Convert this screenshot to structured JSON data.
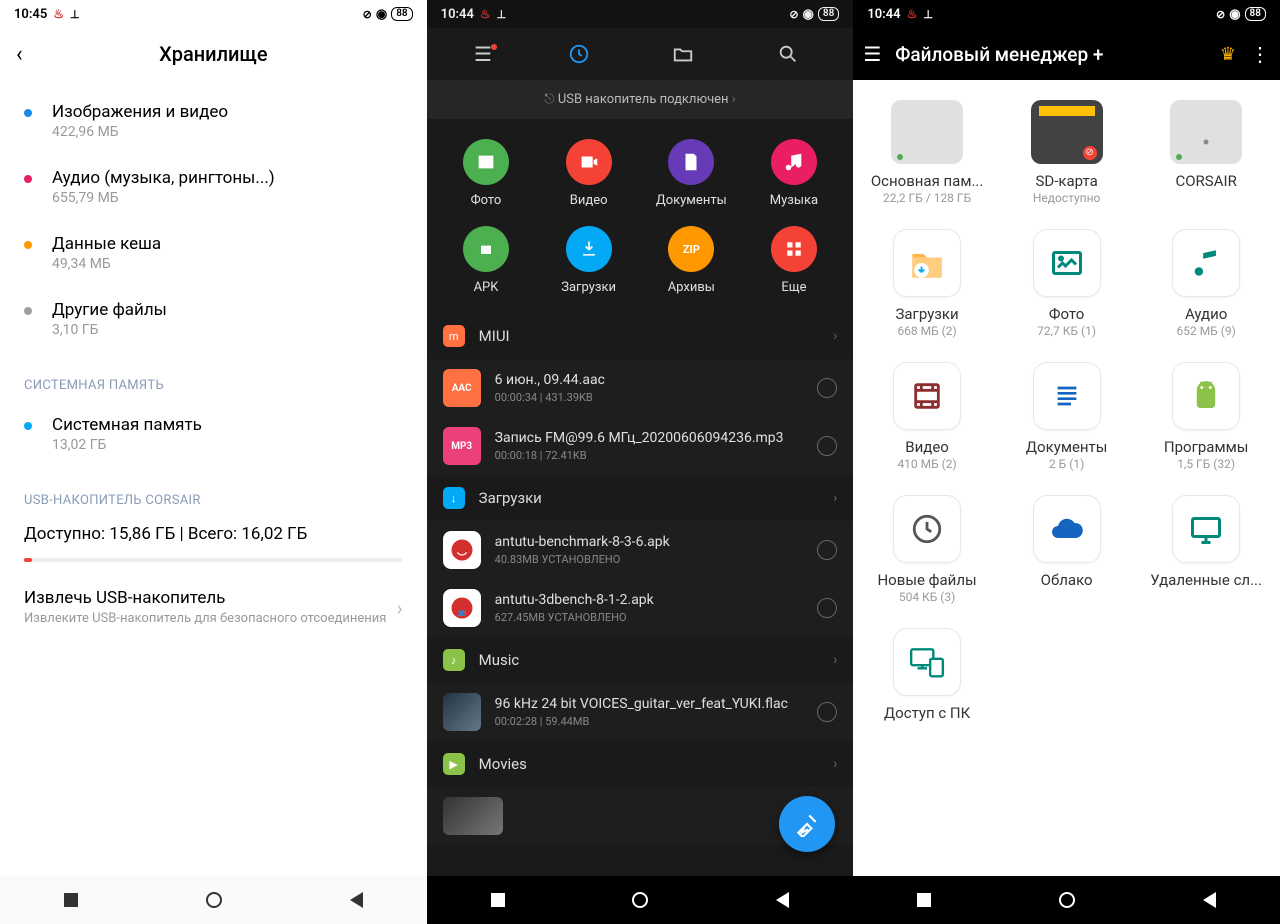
{
  "status": {
    "time1": "10:45",
    "time2": "10:44",
    "time3": "10:44",
    "battery": "88"
  },
  "s1": {
    "title": "Хранилище",
    "items": [
      {
        "label": "Изображения и видео",
        "size": "422,96 МБ",
        "color": "#1e88e5"
      },
      {
        "label": "Аудио (музыка, рингтоны...)",
        "size": "655,79 МБ",
        "color": "#e91e63"
      },
      {
        "label": "Данные кеша",
        "size": "49,34 МБ",
        "color": "#ff9800"
      },
      {
        "label": "Другие файлы",
        "size": "3,10 ГБ",
        "color": "#9e9e9e"
      }
    ],
    "sect_sys": "СИСТЕМНАЯ ПАМЯТЬ",
    "sys_label": "Системная память",
    "sys_size": "13,02 ГБ",
    "sect_usb": "USB-НАКОПИТЕЛЬ CORSAIR",
    "usb_status": "Доступно: 15,86 ГБ | Всего: 16,02 ГБ",
    "eject": "Извлечь USB-накопитель",
    "eject_sub": "Извлеките USB-накопитель для безопасного отсоединения"
  },
  "s2": {
    "banner": "USB накопитель подключен",
    "cats": [
      {
        "label": "Фото",
        "color": "#4caf50"
      },
      {
        "label": "Видео",
        "color": "#f44336"
      },
      {
        "label": "Документы",
        "color": "#673ab7"
      },
      {
        "label": "Музыка",
        "color": "#e91e63"
      },
      {
        "label": "APK",
        "color": "#4caf50"
      },
      {
        "label": "Загрузки",
        "color": "#03a9f4"
      },
      {
        "label": "Архивы",
        "color": "#ff9800"
      },
      {
        "label": "Еще",
        "color": "#f44336"
      }
    ],
    "grp_miui": "MIUI",
    "f1": {
      "name": "6 июн., 09.44.aac",
      "meta": "00:00:34  |  431.39KB"
    },
    "f2": {
      "name": "Запись FM@99.6 МГц_20200606094236.mp3",
      "meta": "00:00:18  |  72.41KB"
    },
    "grp_dl": "Загрузки",
    "f3": {
      "name": "antutu-benchmark-8-3-6.apk",
      "meta": "40.83MB   УСТАНОВЛЕНО"
    },
    "f4": {
      "name": "antutu-3dbench-8-1-2.apk",
      "meta": "627.45MB   УСТАНОВЛЕНО"
    },
    "grp_music": "Music",
    "f5": {
      "name": "96 kHz 24 bit VOICES_guitar_ver_feat_YUKI.flac",
      "meta": "00:02:28  |  59.44MB"
    },
    "grp_movies": "Movies"
  },
  "s3": {
    "title": "Файловый менеджер +",
    "tiles": [
      {
        "label": "Основная пам...",
        "sub": "22,2 ГБ / 128 ГБ"
      },
      {
        "label": "SD-карта",
        "sub": "Недоступно"
      },
      {
        "label": "CORSAIR",
        "sub": ""
      },
      {
        "label": "Загрузки",
        "sub": "668 МБ (2)"
      },
      {
        "label": "Фото",
        "sub": "72,7 КБ (1)"
      },
      {
        "label": "Аудио",
        "sub": "652 МБ (9)"
      },
      {
        "label": "Видео",
        "sub": "410 МБ (2)"
      },
      {
        "label": "Документы",
        "sub": "2 Б (1)"
      },
      {
        "label": "Программы",
        "sub": "1,5 ГБ (32)"
      },
      {
        "label": "Новые файлы",
        "sub": "504 КБ (3)"
      },
      {
        "label": "Облако",
        "sub": ""
      },
      {
        "label": "Удаленные сл...",
        "sub": ""
      },
      {
        "label": "Доступ с ПК",
        "sub": ""
      }
    ]
  }
}
